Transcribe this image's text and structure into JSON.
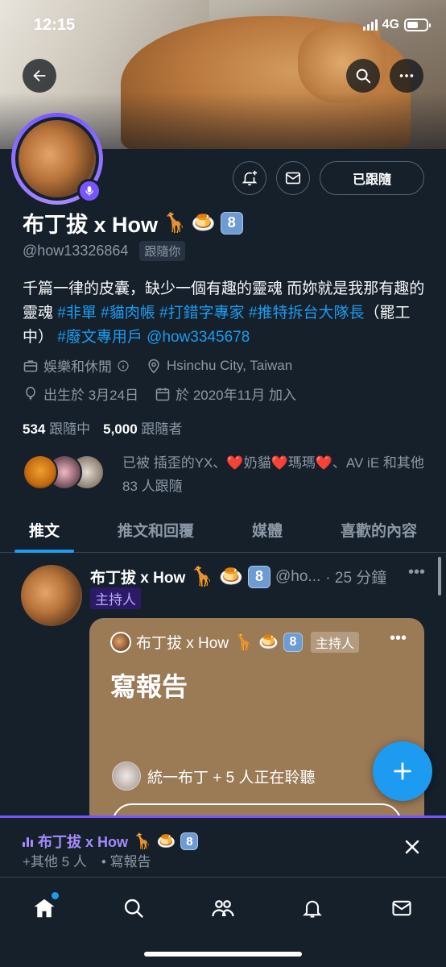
{
  "status": {
    "time": "12:15",
    "network": "4G"
  },
  "profile": {
    "name": "布丁拔 x How",
    "name_emojis": [
      "🦒",
      "🍮"
    ],
    "name_key": "8",
    "handle": "@how13326864",
    "follows_you": "跟隨你",
    "follow_button": "已跟隨",
    "bio_text": "千篇一律的皮囊，缺少一個有趣的靈魂 而妳就是我那有趣的靈魂",
    "bio_tags": [
      "#非單",
      "#貓肉帳",
      "#打錯字專家",
      "#推特拆台大隊長"
    ],
    "bio_mid": "（罷工中）",
    "bio_tail_tag": "#廢文專用戶",
    "bio_mention": "@how3345678",
    "category": "娛樂和休閒",
    "location": "Hsinchu City, Taiwan",
    "birthday": "出生於 3月24日",
    "joined": "於 2020年11月 加入",
    "following_count": "534",
    "following_label": "跟隨中",
    "followers_count": "5,000",
    "followers_label": "跟隨者",
    "followed_by_prefix": "已被 插歪的YX、",
    "followed_by_n1": "奶貓",
    "followed_by_n2": "瑪瑪",
    "followed_by_suffix": "、AV iE 和其他 83 人跟隨"
  },
  "tabs": [
    "推文",
    "推文和回覆",
    "媒體",
    "喜歡的內容"
  ],
  "tweet": {
    "name": "布丁拔 x How",
    "handle": "@ho...",
    "time": "· 25 分鐘",
    "badge": "主持人",
    "space": {
      "host_name": "布丁拔 x How",
      "host_badge": "主持人",
      "title": "寫報告",
      "listening": "統一布丁 + 5 人正在聆聽"
    }
  },
  "dock": {
    "host": "布丁拔 x How",
    "others": "+其他 5 人",
    "title": "• 寫報告"
  },
  "colors": {
    "accent": "#1d9bf0",
    "space_purple": "#7856ff",
    "card": "#9b7a56",
    "bg": "#15202b"
  }
}
